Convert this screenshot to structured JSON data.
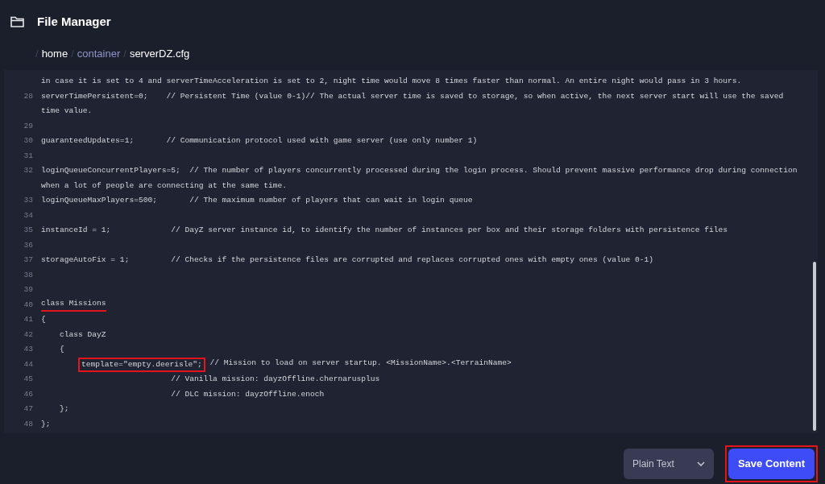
{
  "header": {
    "title": "File Manager"
  },
  "breadcrumb": {
    "separator": "/",
    "items": [
      {
        "label": "home",
        "highlighted": false
      },
      {
        "label": "container",
        "highlighted": true
      },
      {
        "label": "serverDZ.cfg",
        "highlighted": false
      }
    ]
  },
  "editor": {
    "lines": [
      {
        "text": "in case it is set to 4 and serverTimeAcceleration is set to 2, night time would move 8 times faster than normal. An entire night would pass in 3 hours."
      },
      {
        "number": "28",
        "text": "serverTimePersistent=0;    // Persistent Time (value 0-1)// The actual server time is saved to storage, so when active, the next server start will use the saved"
      },
      {
        "text": "time value."
      },
      {
        "number": "29"
      },
      {
        "number": "30",
        "text": "guaranteedUpdates=1;       // Communication protocol used with game server (use only number 1)"
      },
      {
        "number": "31"
      },
      {
        "number": "32",
        "text": "loginQueueConcurrentPlayers=5;  // The number of players concurrently processed during the login process. Should prevent massive performance drop during connection"
      },
      {
        "text": "when a lot of people are connecting at the same time."
      },
      {
        "number": "33",
        "text": "loginQueueMaxPlayers=500;       // The maximum number of players that can wait in login queue"
      },
      {
        "number": "34"
      },
      {
        "number": "35",
        "text": "instanceId = 1;             // DayZ server instance id, to identify the number of instances per box and their storage folders with persistence files"
      },
      {
        "number": "36"
      },
      {
        "number": "37",
        "text": "storageAutoFix = 1;         // Checks if the persistence files are corrupted and replaces corrupted ones with empty ones (value 0-1)"
      },
      {
        "number": "38"
      },
      {
        "number": "39"
      },
      {
        "number": "40",
        "marked": "class Missions",
        "underlined": true
      },
      {
        "number": "41",
        "text": "{"
      },
      {
        "number": "42",
        "text": "    class DayZ"
      },
      {
        "number": "43",
        "text": "    {"
      },
      {
        "number": "44",
        "marked": "        template=\"empty.deerisle\";",
        "boxed": true,
        "text": " // Mission to load on server startup. <MissionName>.<TerrainName>"
      },
      {
        "number": "45",
        "text": "                            // Vanilla mission: dayzOffline.chernarusplus"
      },
      {
        "number": "46",
        "text": "                            // DLC mission: dayzOffline.enoch"
      },
      {
        "number": "47",
        "text": "    };"
      },
      {
        "number": "48",
        "text": "};"
      }
    ]
  },
  "language_select": {
    "value": "Plain Text"
  },
  "save_button": {
    "label": "Save Content",
    "annotated": true
  }
}
